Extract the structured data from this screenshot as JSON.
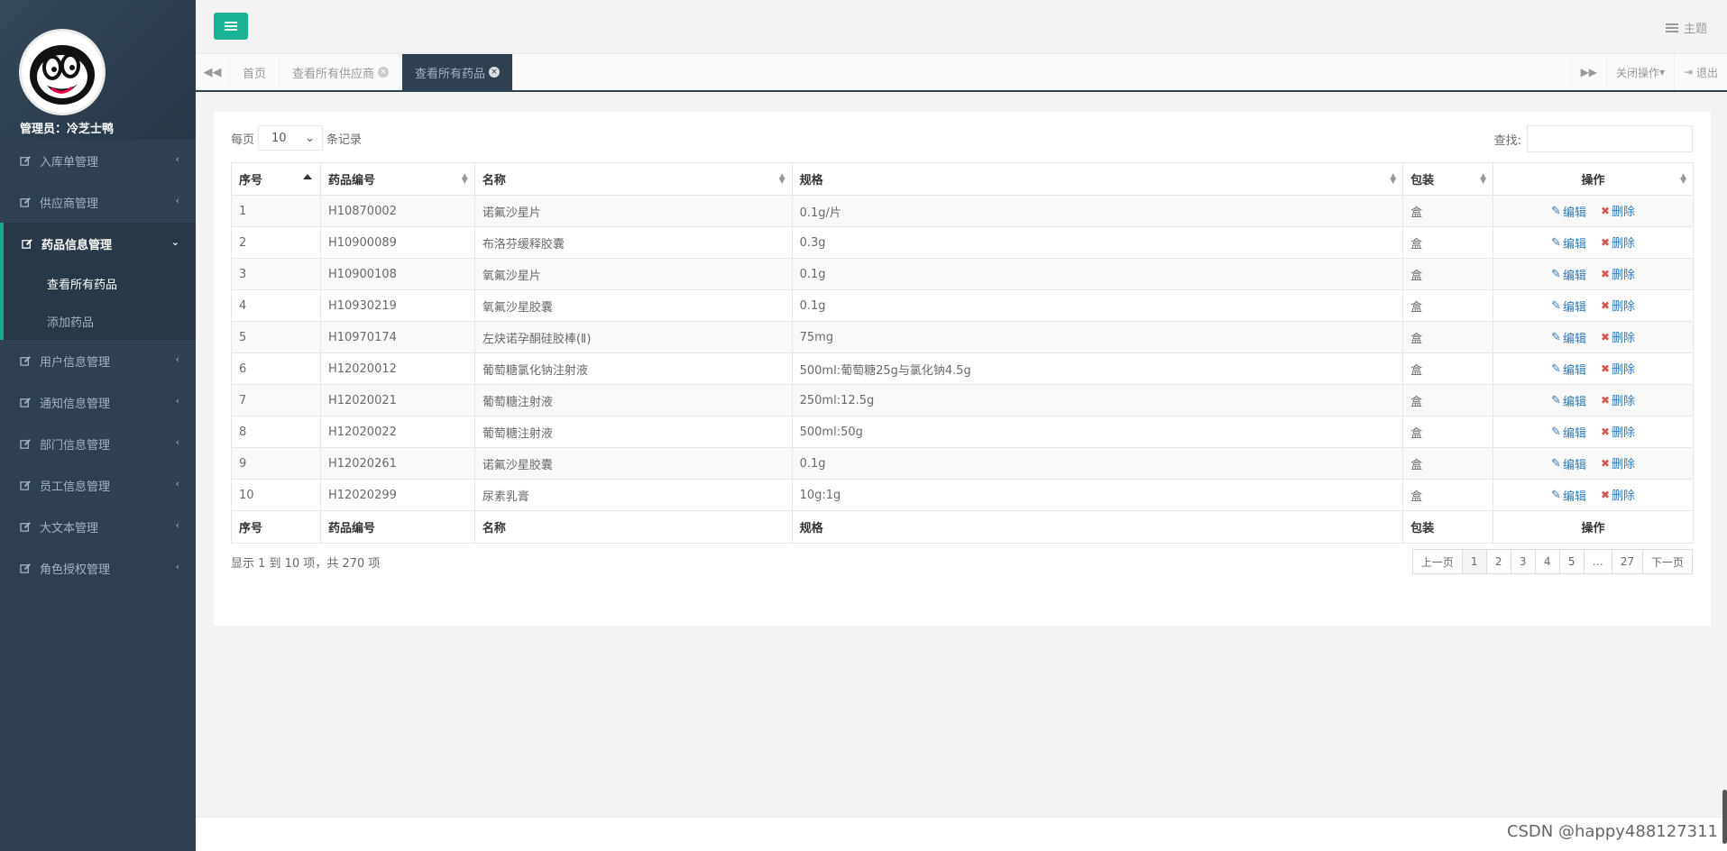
{
  "sidebar": {
    "admin_label": "管理员：",
    "admin_name": "冷芝士鸭",
    "items": [
      {
        "label": "入库单管理"
      },
      {
        "label": "供应商管理"
      },
      {
        "label": "药品信息管理",
        "sub": [
          "查看所有药品",
          "添加药品"
        ]
      },
      {
        "label": "用户信息管理"
      },
      {
        "label": "通知信息管理"
      },
      {
        "label": "部门信息管理"
      },
      {
        "label": "员工信息管理"
      },
      {
        "label": "大文本管理"
      },
      {
        "label": "角色授权管理"
      }
    ]
  },
  "header": {
    "theme_label": "主题"
  },
  "tabs": {
    "items": [
      {
        "label": "首页"
      },
      {
        "label": "查看所有供应商"
      },
      {
        "label": "查看所有药品"
      }
    ],
    "close_ops": "关闭操作",
    "logout": "退出"
  },
  "table_controls": {
    "per_page_prefix": "每页",
    "per_page_value": "10",
    "per_page_suffix": "条记录",
    "search_label": "查找:"
  },
  "table": {
    "headers": [
      "序号",
      "药品编号",
      "名称",
      "规格",
      "包装",
      "操作"
    ],
    "edit_label": "编辑",
    "delete_label": "删除",
    "rows": [
      {
        "no": "1",
        "code": "H10870002",
        "name": "诺氟沙星片",
        "spec": "0.1g/片",
        "pack": "盒"
      },
      {
        "no": "2",
        "code": "H10900089",
        "name": "布洛芬缓释胶囊",
        "spec": "0.3g",
        "pack": "盒"
      },
      {
        "no": "3",
        "code": "H10900108",
        "name": "氧氟沙星片",
        "spec": "0.1g",
        "pack": "盒"
      },
      {
        "no": "4",
        "code": "H10930219",
        "name": "氧氟沙星胶囊",
        "spec": "0.1g",
        "pack": "盒"
      },
      {
        "no": "5",
        "code": "H10970174",
        "name": "左炔诺孕酮硅胶棒(Ⅱ)",
        "spec": "75mg",
        "pack": "盒"
      },
      {
        "no": "6",
        "code": "H12020012",
        "name": "葡萄糖氯化钠注射液",
        "spec": "500ml:葡萄糖25g与氯化钠4.5g",
        "pack": "盒"
      },
      {
        "no": "7",
        "code": "H12020021",
        "name": "葡萄糖注射液",
        "spec": "250ml:12.5g",
        "pack": "盒"
      },
      {
        "no": "8",
        "code": "H12020022",
        "name": "葡萄糖注射液",
        "spec": "500ml:50g",
        "pack": "盒"
      },
      {
        "no": "9",
        "code": "H12020261",
        "name": "诺氟沙星胶囊",
        "spec": "0.1g",
        "pack": "盒"
      },
      {
        "no": "10",
        "code": "H12020299",
        "name": "尿素乳膏",
        "spec": "10g:1g",
        "pack": "盒"
      }
    ]
  },
  "pagination": {
    "info": "显示 1 到 10 项，共 270 项",
    "prev": "上一页",
    "pages": [
      "1",
      "2",
      "3",
      "4",
      "5",
      "…",
      "27"
    ],
    "next": "下一页"
  },
  "watermark": "CSDN @happy488127311"
}
